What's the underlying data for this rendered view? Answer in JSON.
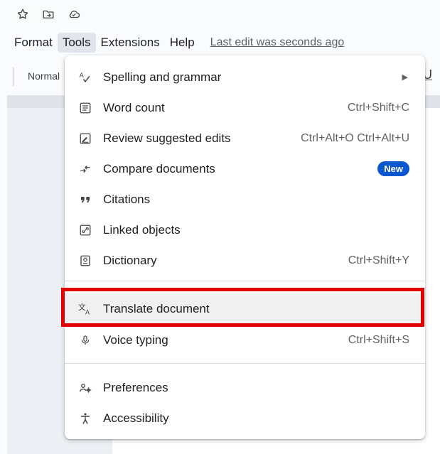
{
  "icons": [
    "star-icon",
    "move-to-folder-icon",
    "cloud-status-icon"
  ],
  "menubar": {
    "format": "Format",
    "tools": "Tools",
    "extensions": "Extensions",
    "help": "Help",
    "last_edit": "Last edit was seconds ago"
  },
  "toolbar": {
    "style": "Normal",
    "underline": "U"
  },
  "tools_menu": {
    "items": [
      {
        "label": "Spelling and grammar",
        "icon": "spellcheck-icon",
        "submenu": true
      },
      {
        "label": "Word count",
        "icon": "word-count-icon",
        "shortcut": "Ctrl+Shift+C"
      },
      {
        "label": "Review suggested edits",
        "icon": "review-edits-icon",
        "shortcut": "Ctrl+Alt+O Ctrl+Alt+U"
      },
      {
        "label": "Compare documents",
        "icon": "compare-icon",
        "badge": "New"
      },
      {
        "label": "Citations",
        "icon": "quote-icon"
      },
      {
        "label": "Linked objects",
        "icon": "link-icon"
      },
      {
        "label": "Dictionary",
        "icon": "dictionary-icon",
        "shortcut": "Ctrl+Shift+Y"
      },
      {
        "label": "Translate document",
        "icon": "translate-icon",
        "highlighted": true
      },
      {
        "label": "Voice typing",
        "icon": "microphone-icon",
        "shortcut": "Ctrl+Shift+S"
      },
      {
        "label": "Preferences",
        "icon": "preferences-icon"
      },
      {
        "label": "Accessibility",
        "icon": "accessibility-icon"
      }
    ]
  },
  "colors": {
    "highlight_box": "#e00000",
    "badge": "#0b57d0",
    "active_menu": "#e1e6ed"
  }
}
